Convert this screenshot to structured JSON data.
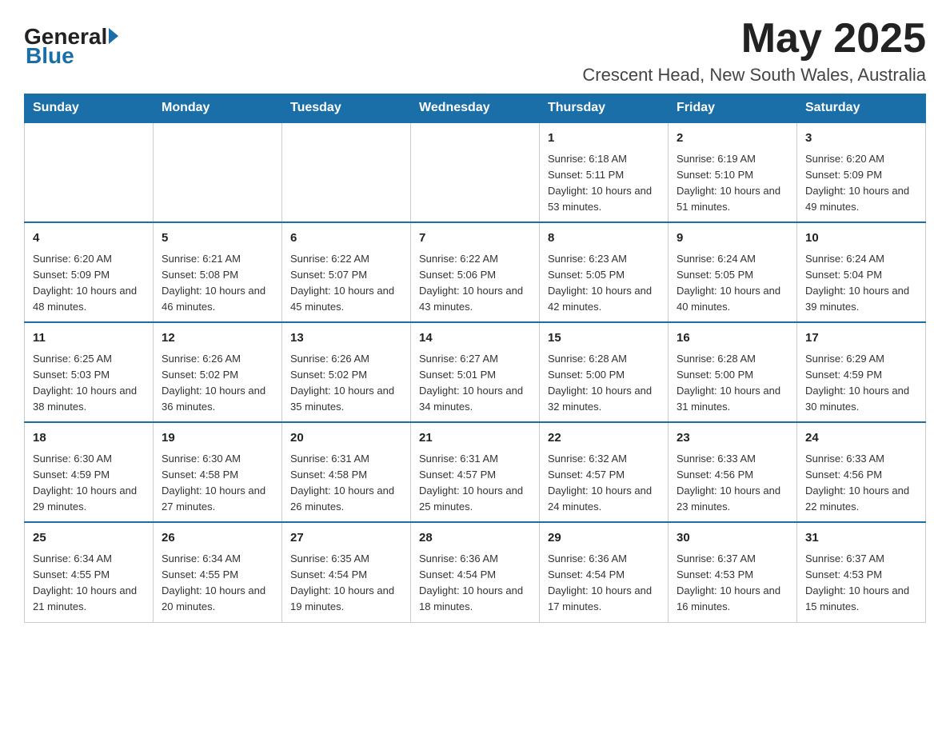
{
  "header": {
    "logo_general": "General",
    "logo_blue": "Blue",
    "month_year": "May 2025",
    "location": "Crescent Head, New South Wales, Australia"
  },
  "days_of_week": [
    "Sunday",
    "Monday",
    "Tuesday",
    "Wednesday",
    "Thursday",
    "Friday",
    "Saturday"
  ],
  "weeks": [
    [
      {
        "day": "",
        "info": ""
      },
      {
        "day": "",
        "info": ""
      },
      {
        "day": "",
        "info": ""
      },
      {
        "day": "",
        "info": ""
      },
      {
        "day": "1",
        "info": "Sunrise: 6:18 AM\nSunset: 5:11 PM\nDaylight: 10 hours and 53 minutes."
      },
      {
        "day": "2",
        "info": "Sunrise: 6:19 AM\nSunset: 5:10 PM\nDaylight: 10 hours and 51 minutes."
      },
      {
        "day": "3",
        "info": "Sunrise: 6:20 AM\nSunset: 5:09 PM\nDaylight: 10 hours and 49 minutes."
      }
    ],
    [
      {
        "day": "4",
        "info": "Sunrise: 6:20 AM\nSunset: 5:09 PM\nDaylight: 10 hours and 48 minutes."
      },
      {
        "day": "5",
        "info": "Sunrise: 6:21 AM\nSunset: 5:08 PM\nDaylight: 10 hours and 46 minutes."
      },
      {
        "day": "6",
        "info": "Sunrise: 6:22 AM\nSunset: 5:07 PM\nDaylight: 10 hours and 45 minutes."
      },
      {
        "day": "7",
        "info": "Sunrise: 6:22 AM\nSunset: 5:06 PM\nDaylight: 10 hours and 43 minutes."
      },
      {
        "day": "8",
        "info": "Sunrise: 6:23 AM\nSunset: 5:05 PM\nDaylight: 10 hours and 42 minutes."
      },
      {
        "day": "9",
        "info": "Sunrise: 6:24 AM\nSunset: 5:05 PM\nDaylight: 10 hours and 40 minutes."
      },
      {
        "day": "10",
        "info": "Sunrise: 6:24 AM\nSunset: 5:04 PM\nDaylight: 10 hours and 39 minutes."
      }
    ],
    [
      {
        "day": "11",
        "info": "Sunrise: 6:25 AM\nSunset: 5:03 PM\nDaylight: 10 hours and 38 minutes."
      },
      {
        "day": "12",
        "info": "Sunrise: 6:26 AM\nSunset: 5:02 PM\nDaylight: 10 hours and 36 minutes."
      },
      {
        "day": "13",
        "info": "Sunrise: 6:26 AM\nSunset: 5:02 PM\nDaylight: 10 hours and 35 minutes."
      },
      {
        "day": "14",
        "info": "Sunrise: 6:27 AM\nSunset: 5:01 PM\nDaylight: 10 hours and 34 minutes."
      },
      {
        "day": "15",
        "info": "Sunrise: 6:28 AM\nSunset: 5:00 PM\nDaylight: 10 hours and 32 minutes."
      },
      {
        "day": "16",
        "info": "Sunrise: 6:28 AM\nSunset: 5:00 PM\nDaylight: 10 hours and 31 minutes."
      },
      {
        "day": "17",
        "info": "Sunrise: 6:29 AM\nSunset: 4:59 PM\nDaylight: 10 hours and 30 minutes."
      }
    ],
    [
      {
        "day": "18",
        "info": "Sunrise: 6:30 AM\nSunset: 4:59 PM\nDaylight: 10 hours and 29 minutes."
      },
      {
        "day": "19",
        "info": "Sunrise: 6:30 AM\nSunset: 4:58 PM\nDaylight: 10 hours and 27 minutes."
      },
      {
        "day": "20",
        "info": "Sunrise: 6:31 AM\nSunset: 4:58 PM\nDaylight: 10 hours and 26 minutes."
      },
      {
        "day": "21",
        "info": "Sunrise: 6:31 AM\nSunset: 4:57 PM\nDaylight: 10 hours and 25 minutes."
      },
      {
        "day": "22",
        "info": "Sunrise: 6:32 AM\nSunset: 4:57 PM\nDaylight: 10 hours and 24 minutes."
      },
      {
        "day": "23",
        "info": "Sunrise: 6:33 AM\nSunset: 4:56 PM\nDaylight: 10 hours and 23 minutes."
      },
      {
        "day": "24",
        "info": "Sunrise: 6:33 AM\nSunset: 4:56 PM\nDaylight: 10 hours and 22 minutes."
      }
    ],
    [
      {
        "day": "25",
        "info": "Sunrise: 6:34 AM\nSunset: 4:55 PM\nDaylight: 10 hours and 21 minutes."
      },
      {
        "day": "26",
        "info": "Sunrise: 6:34 AM\nSunset: 4:55 PM\nDaylight: 10 hours and 20 minutes."
      },
      {
        "day": "27",
        "info": "Sunrise: 6:35 AM\nSunset: 4:54 PM\nDaylight: 10 hours and 19 minutes."
      },
      {
        "day": "28",
        "info": "Sunrise: 6:36 AM\nSunset: 4:54 PM\nDaylight: 10 hours and 18 minutes."
      },
      {
        "day": "29",
        "info": "Sunrise: 6:36 AM\nSunset: 4:54 PM\nDaylight: 10 hours and 17 minutes."
      },
      {
        "day": "30",
        "info": "Sunrise: 6:37 AM\nSunset: 4:53 PM\nDaylight: 10 hours and 16 minutes."
      },
      {
        "day": "31",
        "info": "Sunrise: 6:37 AM\nSunset: 4:53 PM\nDaylight: 10 hours and 15 minutes."
      }
    ]
  ]
}
